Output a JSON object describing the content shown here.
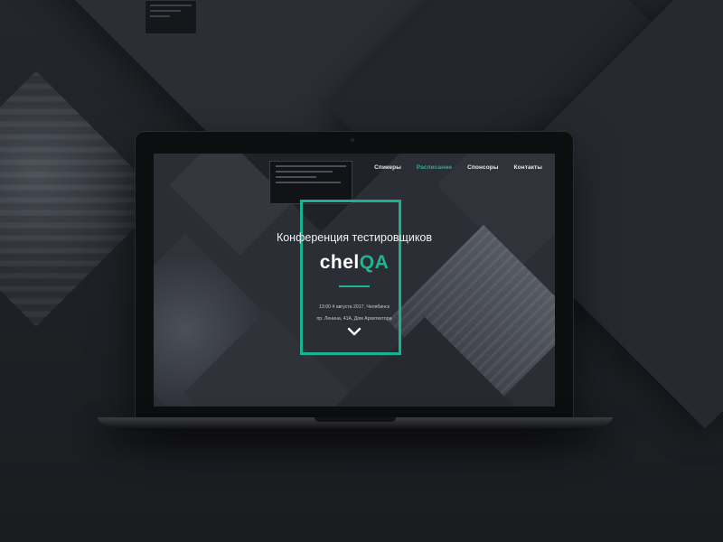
{
  "nav": {
    "items": [
      {
        "label": "Спикеры",
        "active": false
      },
      {
        "label": "Расписание",
        "active": true
      },
      {
        "label": "Спонсоры",
        "active": false
      },
      {
        "label": "Контакты",
        "active": false
      }
    ]
  },
  "hero": {
    "title": "Конференция тестировщиков",
    "logo_main": "chel",
    "logo_accent": "QA",
    "date_line": "13:00 4 августа 2017, Челябинск",
    "address_line": "пр. Ленина, 41А, Дом Архитектора",
    "scroll_icon": "chevron-down-icon"
  },
  "colors": {
    "accent": "#1fb494",
    "background": "#1f2126",
    "text": "#f2f3f5"
  }
}
